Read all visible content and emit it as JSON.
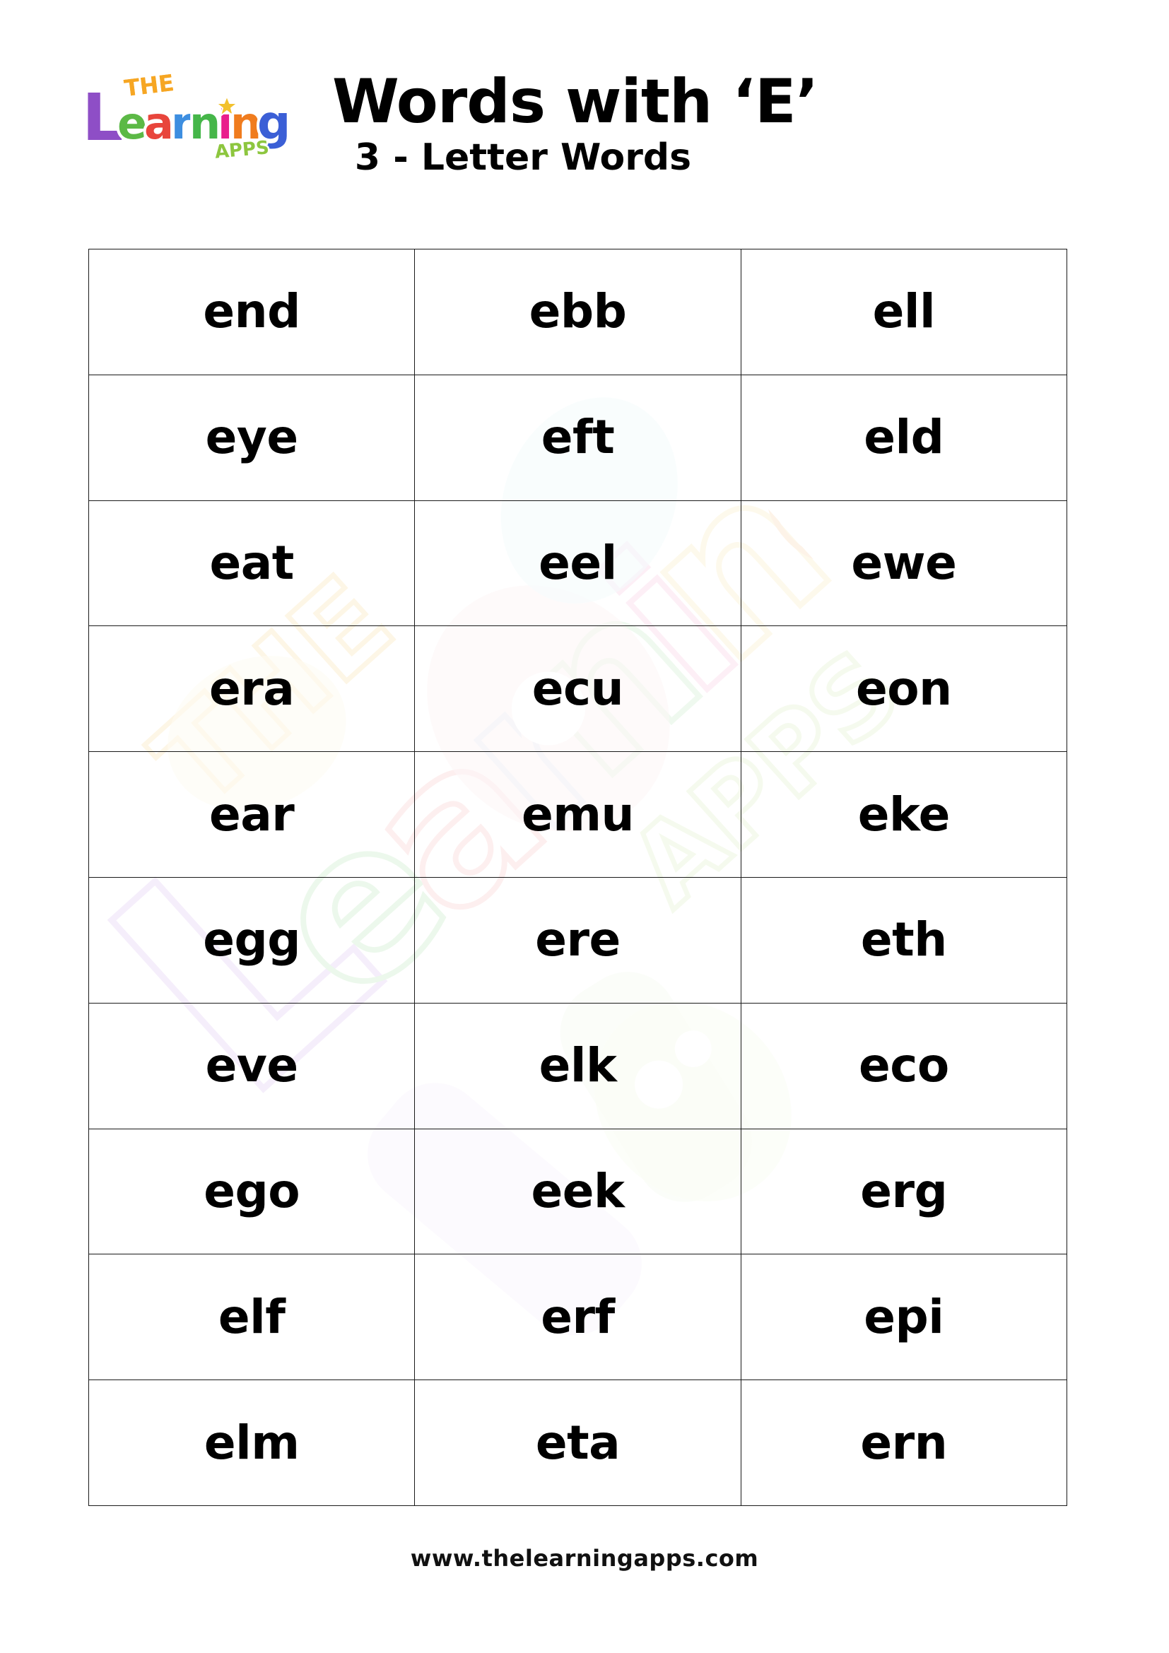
{
  "header": {
    "title": "Words with ‘E’",
    "subtitle": "3 - Letter Words",
    "logo": {
      "line1": "THE",
      "line2": "Learning",
      "line3": "APPS",
      "colors": {
        "the": "#f6a623",
        "l": "#8e4ec6",
        "e": "#5cb946",
        "a": "#e8453c",
        "r": "#3d8ee0",
        "n": "#45b649",
        "i": "#e91e8c",
        "n2": "#f2c12e",
        "g": "#f07c1e",
        "final_g": "#3b5fd6",
        "apps": "#8dc63f"
      }
    }
  },
  "table": {
    "columns": 3,
    "rows": [
      [
        "end",
        "ebb",
        "ell"
      ],
      [
        "eye",
        "eft",
        "eld"
      ],
      [
        "eat",
        "eel",
        "ewe"
      ],
      [
        "era",
        "ecu",
        "eon"
      ],
      [
        "ear",
        "emu",
        "eke"
      ],
      [
        "egg",
        "ere",
        "eth"
      ],
      [
        "eve",
        "elk",
        "eco"
      ],
      [
        "ego",
        "eek",
        "erg"
      ],
      [
        "elf",
        "erf",
        "epi"
      ],
      [
        "elm",
        "eta",
        "ern"
      ]
    ],
    "border_color": "#1a1a1a"
  },
  "watermark": {
    "description": "faded pastel Learning Apps logo",
    "opacity": "0.16"
  },
  "footer": {
    "url": "www.thelearningapps.com"
  }
}
